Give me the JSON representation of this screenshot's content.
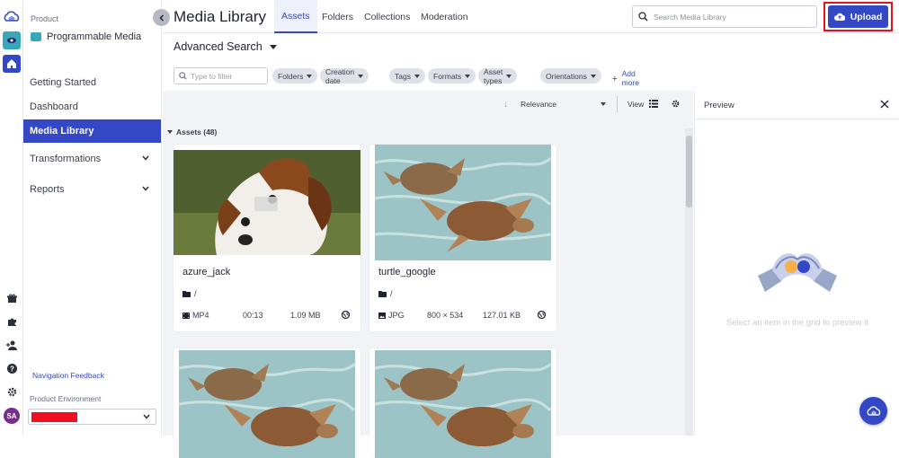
{
  "sidebar": {
    "product_label": "Product",
    "product_name": "Programmable Media",
    "items": [
      {
        "label": "Getting Started"
      },
      {
        "label": "Dashboard"
      },
      {
        "label": "Media Library"
      },
      {
        "label": "Transformations"
      },
      {
        "label": "Reports"
      }
    ],
    "nav_feedback": "Navigation Feedback",
    "env_label": "Product Environment",
    "avatar_initials": "SA"
  },
  "header": {
    "title": "Media Library",
    "tabs": [
      {
        "label": "Assets",
        "active": true
      },
      {
        "label": "Folders"
      },
      {
        "label": "Collections"
      },
      {
        "label": "Moderation"
      }
    ],
    "search_placeholder": "Search Media Library",
    "upload_label": "Upload"
  },
  "toolbar": {
    "advanced_search": "Advanced Search",
    "filter_placeholder": "Type to filter",
    "filter_chips": [
      "Folders",
      "Creation date",
      "Tags",
      "Formats",
      "Asset types",
      "Orientations"
    ],
    "add_more": "Add more"
  },
  "sort": {
    "relevance": "Relevance",
    "view_label": "View"
  },
  "assets": {
    "header": "Assets (48)",
    "cards": [
      {
        "name": "azure_jack",
        "path": "/",
        "format": "MP4",
        "duration": "00:13",
        "size": "1.09 MB"
      },
      {
        "name": "turtle_google",
        "path": "/",
        "format": "JPG",
        "dimensions": "800 × 534",
        "size": "127.01 KB"
      }
    ]
  },
  "preview": {
    "title": "Preview",
    "hint": "Select an item in the grid to preview it"
  },
  "colors": {
    "accent": "#3448c5",
    "highlight": "#e0141e",
    "env_redacted": "#f0101f"
  }
}
